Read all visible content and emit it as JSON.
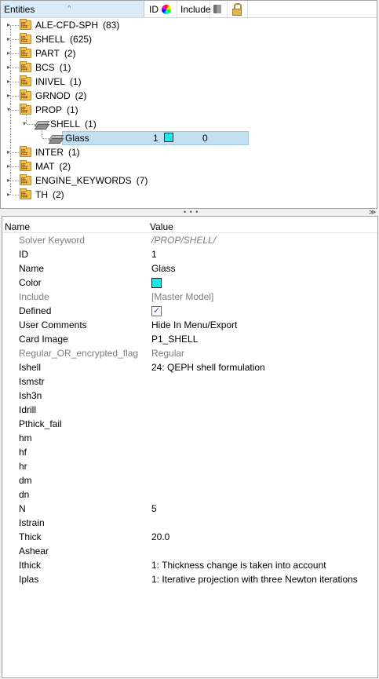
{
  "tree_header": {
    "entities_label": "Entities",
    "id_label": "ID",
    "include_label": "Include",
    "icons": [
      "sort-ascending-icon",
      "color-wheel-icon",
      "cube-icon",
      "lock-icon"
    ]
  },
  "tree": [
    {
      "label": "ALE-CFD-SPH",
      "count": "(83)",
      "level": 0,
      "expanded": false
    },
    {
      "label": "SHELL",
      "count": "(625)",
      "level": 0,
      "expanded": false
    },
    {
      "label": "PART",
      "count": "(2)",
      "level": 0,
      "expanded": false
    },
    {
      "label": "BCS",
      "count": "(1)",
      "level": 0,
      "expanded": false
    },
    {
      "label": "INIVEL",
      "count": "(1)",
      "level": 0,
      "expanded": false
    },
    {
      "label": "GRNOD",
      "count": "(2)",
      "level": 0,
      "expanded": false
    },
    {
      "label": "PROP",
      "count": "(1)",
      "level": 0,
      "expanded": true
    },
    {
      "label": "SHELL",
      "count": "(1)",
      "level": 1,
      "expanded": true
    },
    {
      "label": "Glass",
      "id": "1",
      "include": "0",
      "level": 2,
      "selected": true,
      "color": "#1ee6e6"
    },
    {
      "label": "INTER",
      "count": "(1)",
      "level": 0,
      "expanded": false
    },
    {
      "label": "MAT",
      "count": "(2)",
      "level": 0,
      "expanded": false
    },
    {
      "label": "ENGINE_KEYWORDS",
      "count": "(7)",
      "level": 0,
      "expanded": false
    },
    {
      "label": "TH",
      "count": "(2)",
      "level": 0,
      "expanded": false
    }
  ],
  "props_header": {
    "name": "Name",
    "value": "Value"
  },
  "props": {
    "solver_keyword": {
      "name": "Solver Keyword",
      "value": "/PROP/SHELL/"
    },
    "id": {
      "name": "ID",
      "value": "1"
    },
    "name": {
      "name": "Name",
      "value": "Glass"
    },
    "color": {
      "name": "Color",
      "swatch": "#1ee6e6"
    },
    "include": {
      "name": "Include",
      "value": "[Master Model]"
    },
    "defined": {
      "name": "Defined",
      "checked": true,
      "check_glyph": "✓"
    },
    "user_comments": {
      "name": "User Comments",
      "value": "Hide In Menu/Export"
    },
    "card_image": {
      "name": "Card Image",
      "value": "P1_SHELL"
    },
    "flag": {
      "name": "Regular_OR_encrypted_flag",
      "value": "Regular"
    },
    "ishell": {
      "name": "Ishell",
      "value": "24: QEPH shell formulation"
    },
    "ismstr": {
      "name": "Ismstr",
      "value": ""
    },
    "ish3n": {
      "name": "Ish3n",
      "value": ""
    },
    "idrill": {
      "name": "Idrill",
      "value": ""
    },
    "pthick_fail": {
      "name": "Pthick_fail",
      "value": ""
    },
    "hm": {
      "name": "hm",
      "value": ""
    },
    "hf": {
      "name": "hf",
      "value": ""
    },
    "hr": {
      "name": "hr",
      "value": ""
    },
    "dm": {
      "name": "dm",
      "value": ""
    },
    "dn": {
      "name": "dn",
      "value": ""
    },
    "n": {
      "name": "N",
      "value": "5"
    },
    "istrain": {
      "name": "Istrain",
      "value": ""
    },
    "thick": {
      "name": "Thick",
      "value": "20.0"
    },
    "ashear": {
      "name": "Ashear",
      "value": ""
    },
    "ithick": {
      "name": "Ithick",
      "value": "1: Thickness change is taken into account"
    },
    "iplas": {
      "name": "Iplas",
      "value": "1: Iterative projection with three Newton iterations"
    }
  },
  "splitter": {
    "grip": "• • •",
    "collapse_glyph": "≫"
  }
}
